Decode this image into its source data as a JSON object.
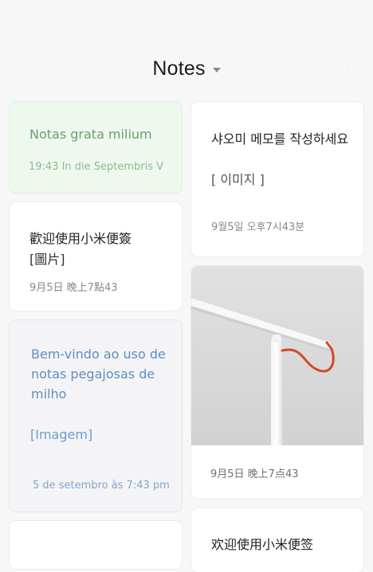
{
  "header": {
    "title": "Notes",
    "dropdown_icon": "caret-down-icon",
    "menu_icon": "more-vertical-icon"
  },
  "notes": {
    "green": {
      "title": "Notas grata milium",
      "date": "19:43 In die Septembris V",
      "color": "#eef8ee"
    },
    "chinese": {
      "title": "歡迎使用小米便簽",
      "image_tag": "[圖片]",
      "date": "9月5日 晚上7點43"
    },
    "blue": {
      "text": "Bem-vindo ao uso de notas pegajosas de milho",
      "image_tag": "[Imagem]",
      "date": "5 de setembro às 7:43 pm",
      "color": "#f4f4f6"
    },
    "korean": {
      "title": "샤오미 메모를 작성하세요",
      "image_tag": "[ 이미지 ]",
      "date": "9월5일  오후7시43분"
    },
    "image_note": {
      "image": "desk-lamp-photo",
      "date": "9月5日 晚上7点43"
    },
    "partial_bottom": {
      "title": "欢迎使用小米便签"
    }
  }
}
